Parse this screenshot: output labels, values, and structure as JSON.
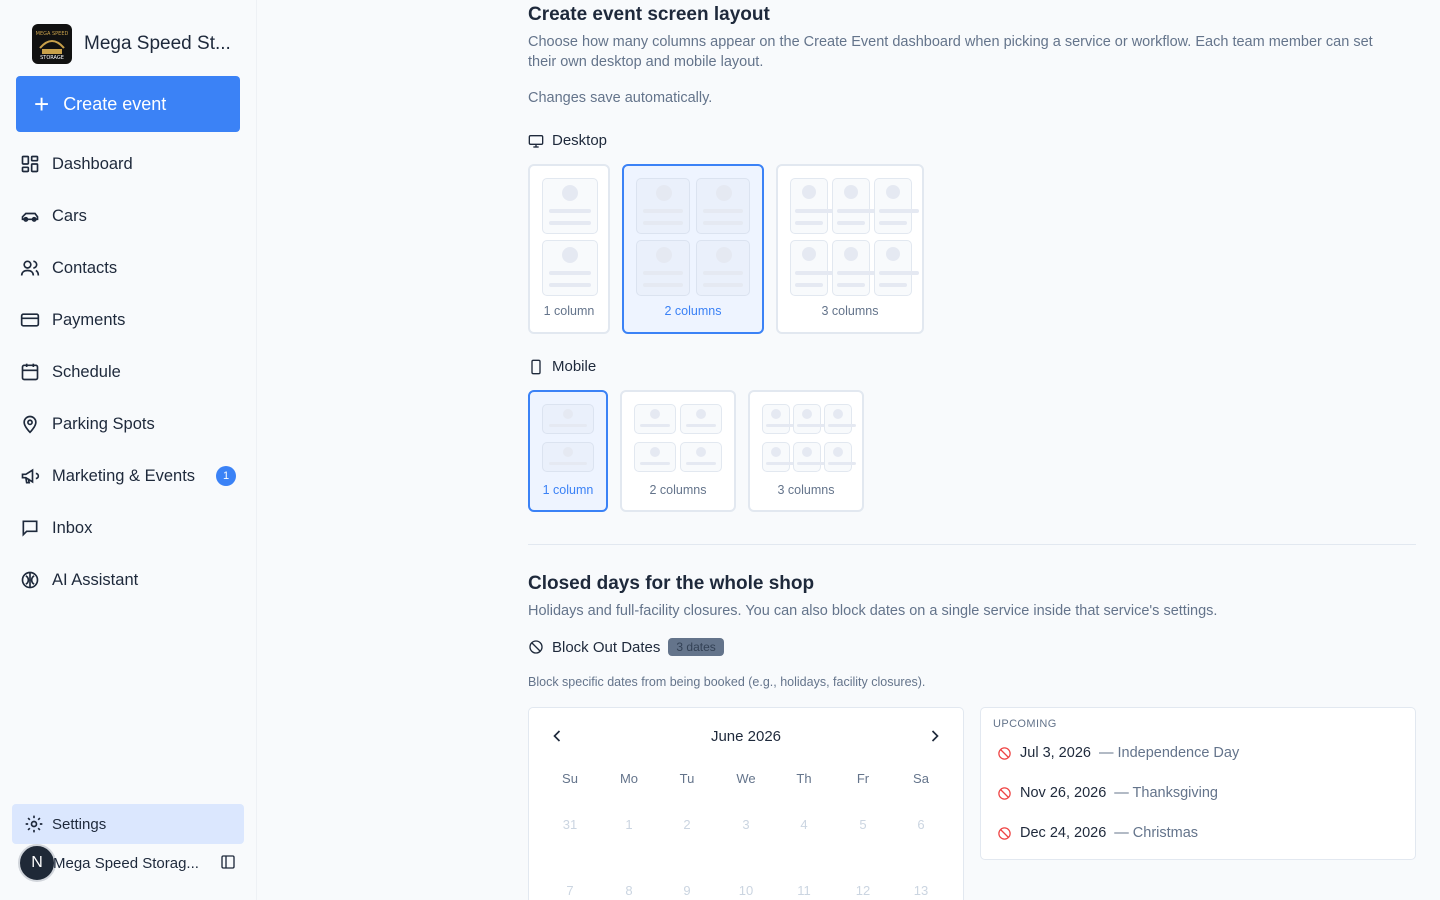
{
  "sidebar": {
    "brand_name": "Mega Speed St...",
    "logo_text_top": "MEGA SPEED",
    "logo_text_bottom": "STORAGE",
    "create_label": "Create event",
    "items": [
      {
        "label": "Dashboard",
        "icon": "dashboard-icon"
      },
      {
        "label": "Cars",
        "icon": "car-icon"
      },
      {
        "label": "Contacts",
        "icon": "contacts-icon"
      },
      {
        "label": "Payments",
        "icon": "credit-card-icon"
      },
      {
        "label": "Schedule",
        "icon": "calendar-icon"
      },
      {
        "label": "Parking Spots",
        "icon": "map-pin-icon"
      },
      {
        "label": "Marketing & Events",
        "icon": "megaphone-icon",
        "badge": "1"
      },
      {
        "label": "Inbox",
        "icon": "message-square-icon"
      },
      {
        "label": "AI Assistant",
        "icon": "brain-icon"
      }
    ],
    "settings_label": "Settings",
    "user_initial": "N",
    "user_name": "Mega Speed Storag..."
  },
  "layout_section": {
    "title": "Create event screen layout",
    "description": "Choose how many columns appear on the Create Event dashboard when picking a service or workflow. Each team member can set their own desktop and mobile layout.",
    "autosave_note": "Changes save automatically.",
    "desktop_label": "Desktop",
    "desktop_options": [
      "1 column",
      "2 columns",
      "3 columns"
    ],
    "desktop_selected": "2 columns",
    "mobile_label": "Mobile",
    "mobile_options": [
      "1 column",
      "2 columns",
      "3 columns"
    ],
    "mobile_selected": "1 column"
  },
  "closed_section": {
    "title": "Closed days for the whole shop",
    "description": "Holidays and full-facility closures. You can also block dates on a single service inside that service's settings.",
    "block_label": "Block Out Dates",
    "block_count": "3 dates",
    "block_help": "Block specific dates from being booked (e.g., holidays, facility closures).",
    "calendar": {
      "month": "June 2026",
      "weekdays": [
        "Su",
        "Mo",
        "Tu",
        "We",
        "Th",
        "Fr",
        "Sa"
      ],
      "week1": [
        "31",
        "1",
        "2",
        "3",
        "4",
        "5",
        "6"
      ],
      "week2": [
        "7",
        "8",
        "9",
        "10",
        "11",
        "12",
        "13"
      ]
    },
    "upcoming_title": "UPCOMING",
    "upcoming": [
      {
        "date": "Jul 3, 2026",
        "name": "— Independence Day"
      },
      {
        "date": "Nov 26, 2026",
        "name": "— Thanksgiving"
      },
      {
        "date": "Dec 24, 2026",
        "name": "— Christmas"
      }
    ]
  },
  "colors": {
    "accent": "#3b82f6",
    "text": "#1e293b",
    "muted": "#64748b",
    "danger": "#ef4444"
  }
}
